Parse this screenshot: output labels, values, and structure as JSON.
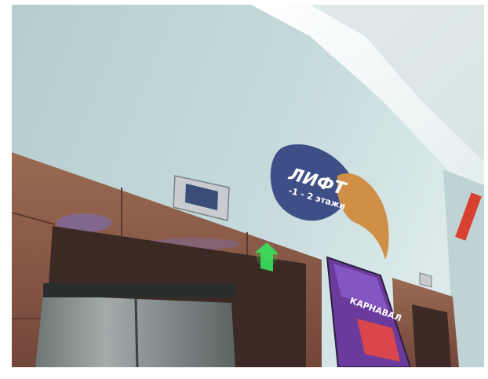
{
  "scene": {
    "description": "Elevator lobby in a shopping mall with a wall sign and green floor indicator"
  },
  "sign": {
    "title": "ЛИФТ",
    "subtitle": "-1 - 2 этажи"
  },
  "poster": {
    "text": "КАРНАВАЛ"
  },
  "colors": {
    "wall": "#b7cfd0",
    "ceiling_light": "#f5fbfb",
    "trim_brown": "#8a5a45",
    "sign_blue": "#3d4f86",
    "sign_orange": "#d08f45",
    "indicator_green": "#3be05c",
    "door_steel": "#8c9495"
  },
  "icons": {
    "floor_indicator": "green-led-arrow-icon"
  }
}
